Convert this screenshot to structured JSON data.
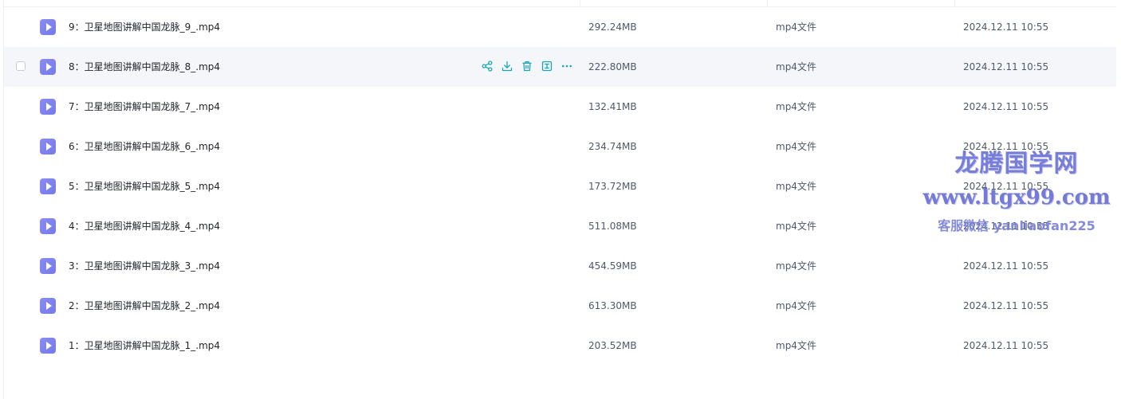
{
  "files": [
    {
      "name": "9：卫星地图讲解中国龙脉_9_.mp4",
      "size": "292.24MB",
      "type": "mp4文件",
      "date": "2024.12.11 10:55"
    },
    {
      "name": "8：卫星地图讲解中国龙脉_8_.mp4",
      "size": "222.80MB",
      "type": "mp4文件",
      "date": "2024.12.11 10:55"
    },
    {
      "name": "7：卫星地图讲解中国龙脉_7_.mp4",
      "size": "132.41MB",
      "type": "mp4文件",
      "date": "2024.12.11 10:55"
    },
    {
      "name": "6：卫星地图讲解中国龙脉_6_.mp4",
      "size": "234.74MB",
      "type": "mp4文件",
      "date": "2024.12.11 10:55"
    },
    {
      "name": "5：卫星地图讲解中国龙脉_5_.mp4",
      "size": "173.72MB",
      "type": "mp4文件",
      "date": "2024.12.11 10:55"
    },
    {
      "name": "4：卫星地图讲解中国龙脉_4_.mp4",
      "size": "511.08MB",
      "type": "mp4文件",
      "date": "2024.12.11 10:55"
    },
    {
      "name": "3：卫星地图讲解中国龙脉_3_.mp4",
      "size": "454.59MB",
      "type": "mp4文件",
      "date": "2024.12.11 10:55"
    },
    {
      "name": "2：卫星地图讲解中国龙脉_2_.mp4",
      "size": "613.30MB",
      "type": "mp4文件",
      "date": "2024.12.11 10:55"
    },
    {
      "name": "1：卫星地图讲解中国龙脉_1_.mp4",
      "size": "203.52MB",
      "type": "mp4文件",
      "date": "2024.12.11 10:55"
    }
  ],
  "hovered_row_index": 1,
  "row_actions": [
    "share-icon",
    "download-icon",
    "delete-icon",
    "rename-icon",
    "more-icon"
  ],
  "colors": {
    "accent": "#1aa6b7",
    "file_icon": "#7b7ff0",
    "hover_row": "#f5f6f9",
    "watermark": "#6d74d4"
  },
  "watermark": {
    "line1": "龙腾国学网",
    "line2": "www.ltgx99.com",
    "line3": "客服微信 yanliaofan225"
  }
}
